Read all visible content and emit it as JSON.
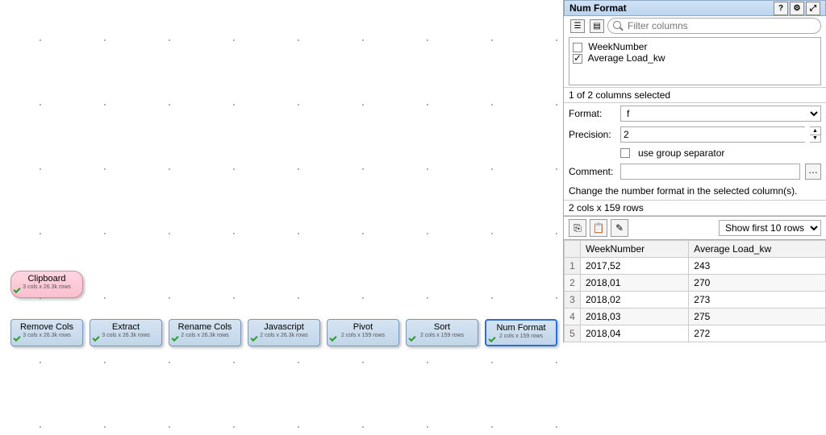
{
  "canvas": {
    "clipboard": {
      "label": "Clipboard",
      "sub": "3 cols x 26.3k rows"
    },
    "nodes": [
      {
        "label": "Remove Cols",
        "sub": "3 cols x 26.3k rows"
      },
      {
        "label": "Extract",
        "sub": "3 cols x 26.3k rows"
      },
      {
        "label": "Rename Cols",
        "sub": "2 cols x 26.3k rows"
      },
      {
        "label": "Javascript",
        "sub": "2 cols x 26.3k rows"
      },
      {
        "label": "Pivot",
        "sub": "2 cols x 159 rows"
      },
      {
        "label": "Sort",
        "sub": "2 cols x 159 rows"
      },
      {
        "label": "Num Format",
        "sub": "2 cols x 159 rows"
      }
    ]
  },
  "panel": {
    "title": "Num Format",
    "search_placeholder": "Filter columns",
    "columns": [
      {
        "name": "WeekNumber",
        "checked": false
      },
      {
        "name": "Average Load_kw",
        "checked": true
      }
    ],
    "selected_status": "1 of 2 columns selected",
    "format_label": "Format:",
    "format_value": "f",
    "precision_label": "Precision:",
    "precision_value": "2",
    "group_sep_label": "use group separator",
    "group_sep_checked": false,
    "comment_label": "Comment:",
    "comment_value": "",
    "hint": "Change the number format in the selected column(s).",
    "table_summary": "2 cols x 159 rows",
    "show_first_label": "Show first 10 rows",
    "table": {
      "headers": [
        "WeekNumber",
        "Average Load_kw"
      ],
      "rows": [
        [
          "2017,52",
          "243"
        ],
        [
          "2018,01",
          "270"
        ],
        [
          "2018,02",
          "273"
        ],
        [
          "2018,03",
          "275"
        ],
        [
          "2018,04",
          "272"
        ]
      ]
    }
  }
}
